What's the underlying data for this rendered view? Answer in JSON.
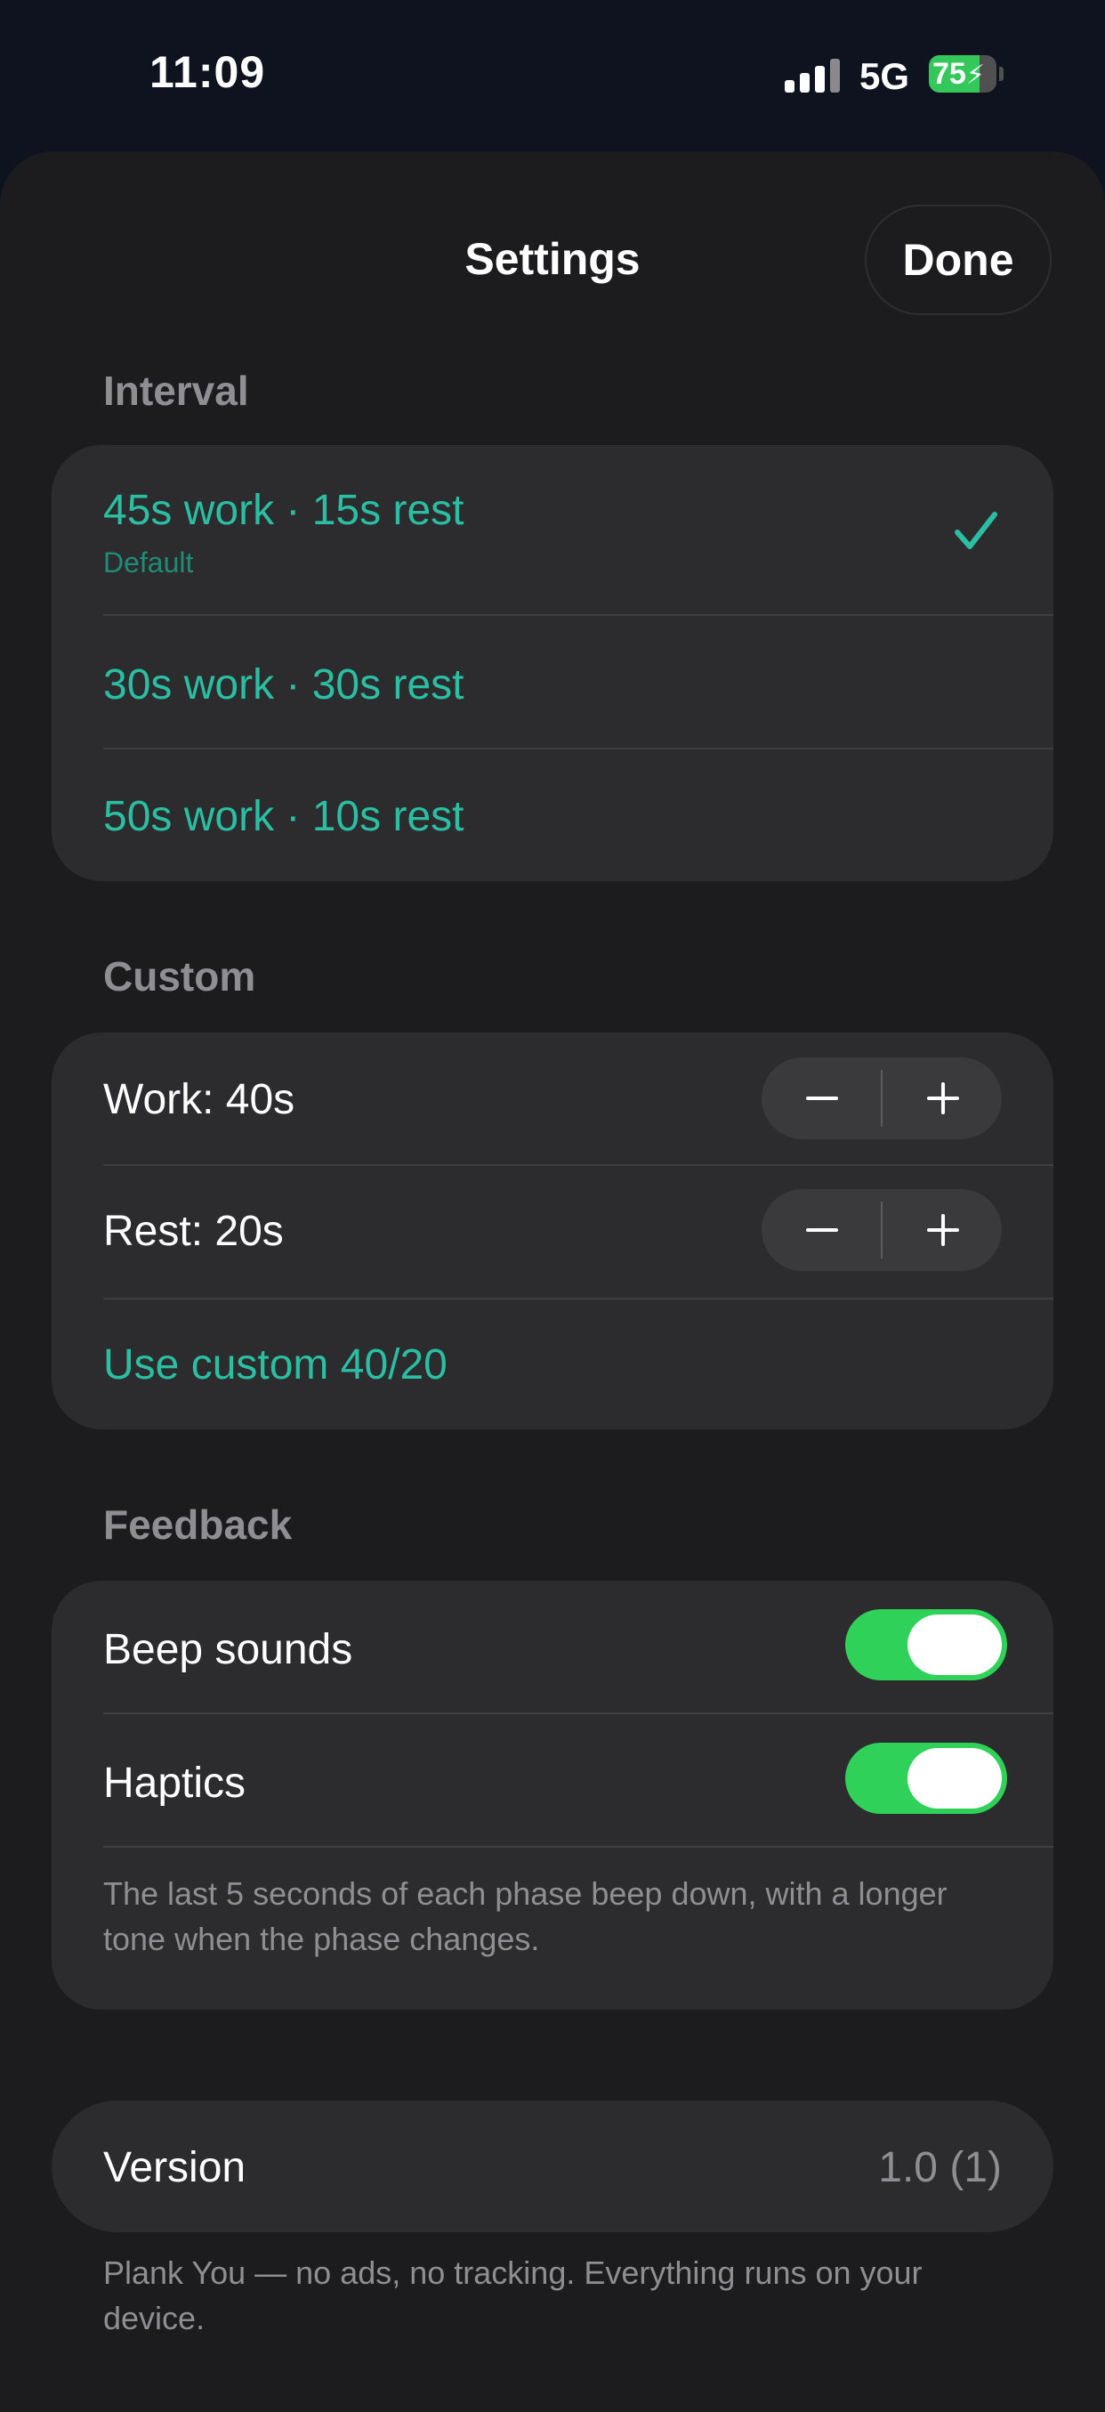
{
  "status_bar": {
    "time": "11:09",
    "network": "5G",
    "battery": "75",
    "battery_fraction": 0.75,
    "icons": [
      "signal-icon",
      "battery-charging-icon"
    ]
  },
  "header": {
    "title": "Settings",
    "done_label": "Done"
  },
  "interval": {
    "header": "Interval",
    "options": [
      {
        "label": "45s work · 15s rest",
        "subtitle": "Default",
        "selected": true
      },
      {
        "label": "30s work · 30s rest",
        "selected": false
      },
      {
        "label": "50s work · 10s rest",
        "selected": false
      }
    ]
  },
  "custom": {
    "header": "Custom",
    "work_label": "Work: 40s",
    "rest_label": "Rest: 20s",
    "use_label": "Use custom 40/20"
  },
  "feedback": {
    "header": "Feedback",
    "beep_label": "Beep sounds",
    "beep_on": true,
    "haptics_label": "Haptics",
    "haptics_on": true,
    "note": "The last 5 seconds of each phase beep down, with a longer tone when the phase changes."
  },
  "about": {
    "version_label": "Version",
    "version_value": "1.0 (1)",
    "footnote": "Plank You — no ads, no tracking. Everything runs on your device."
  },
  "colors": {
    "accent": "#2abfa3",
    "toggle_on": "#30d158",
    "card": "#2c2c2e",
    "sheet": "#1c1c1e"
  }
}
